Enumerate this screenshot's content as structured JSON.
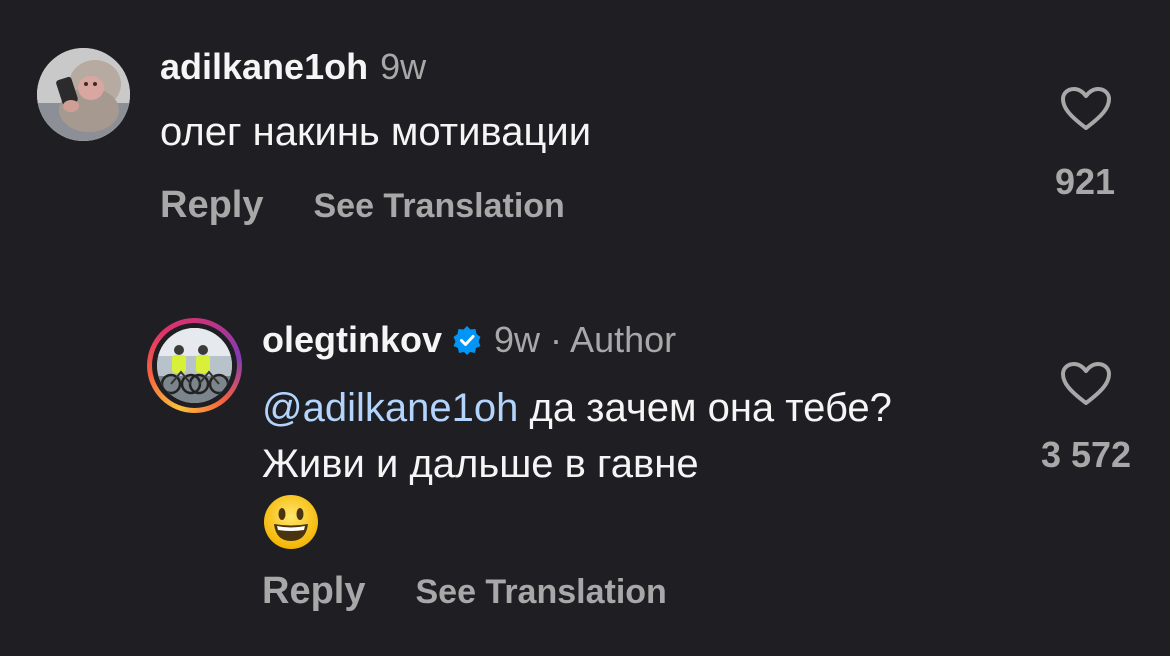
{
  "comments": [
    {
      "username": "adilkane1oh",
      "time": "9w",
      "text": "олег накинь мотивации",
      "reply_label": "Reply",
      "translate_label": "See Translation",
      "like_count": "921",
      "avatar_icon": "monkey-with-phone-avatar"
    },
    {
      "username": "olegtinkov",
      "verified": true,
      "time": "9w · Author",
      "mention": "@adilkane1oh",
      "text": " да зачем она тебе? Живи и дальше в гавне",
      "emoji": "grinning-face-emoji",
      "reply_label": "Reply",
      "translate_label": "See Translation",
      "like_count": "3 572",
      "avatar_icon": "cyclists-avatar"
    }
  ],
  "colors": {
    "background": "#1f1f23",
    "text_primary": "#f5f5f5",
    "text_secondary": "#a8a8a8",
    "mention": "#b3d4fc",
    "verified": "#0095f6"
  }
}
